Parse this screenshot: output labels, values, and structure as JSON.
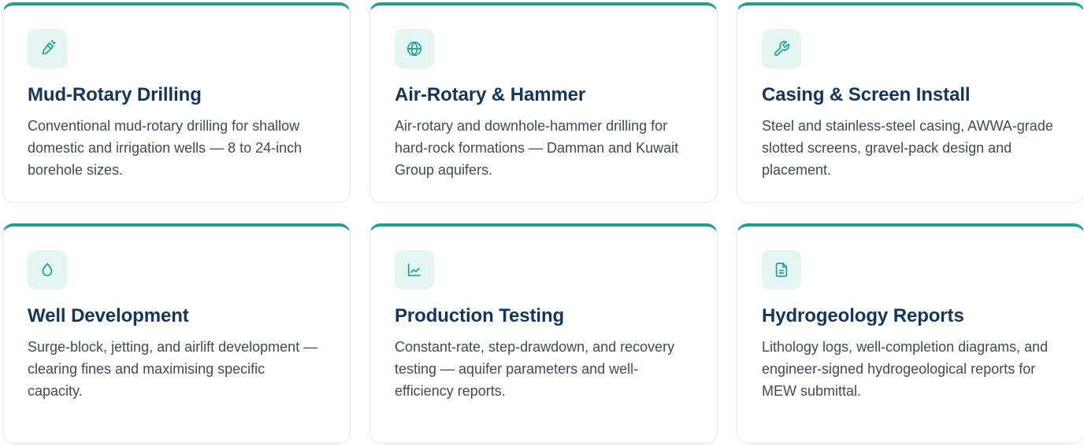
{
  "theme": {
    "accent": "#1aa394",
    "icon_bg": "#e4f5f2",
    "title_color": "#13365e",
    "text_color": "#3f4b57",
    "border_color": "#e2e8ee"
  },
  "services": [
    {
      "icon": "drill-icon",
      "title": "Mud-Rotary Drilling",
      "description": "Conventional mud-rotary drilling for shallow domestic and irrigation wells — 8 to 24-inch borehole sizes."
    },
    {
      "icon": "globe-icon",
      "title": "Air-Rotary & Hammer",
      "description": "Air-rotary and downhole-hammer drilling for hard-rock formations — Damman and Kuwait Group aquifers."
    },
    {
      "icon": "wrench-icon",
      "title": "Casing & Screen Install",
      "description": "Steel and stainless-steel casing, AWWA-grade slotted screens, gravel-pack design and placement."
    },
    {
      "icon": "droplet-icon",
      "title": "Well Development",
      "description": "Surge-block, jetting, and airlift development — clearing fines and maximising specific capacity."
    },
    {
      "icon": "line-chart-icon",
      "title": "Production Testing",
      "description": "Constant-rate, step-drawdown, and recovery testing — aquifer parameters and well-efficiency reports."
    },
    {
      "icon": "file-text-icon",
      "title": "Hydrogeology Reports",
      "description": "Lithology logs, well-completion diagrams, and engineer-signed hydrogeological reports for MEW submittal."
    }
  ]
}
